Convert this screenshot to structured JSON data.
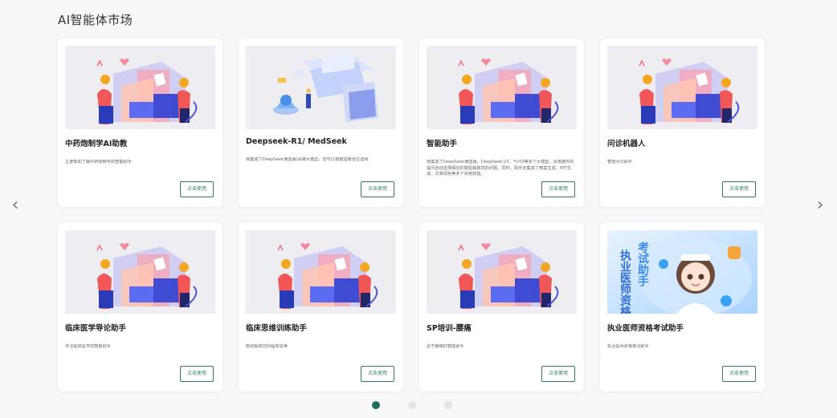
{
  "page": {
    "title": "AI智能体市场"
  },
  "nav": {
    "prev_icon": "chevron-left-icon",
    "next_icon": "chevron-right-icon",
    "prev_glyph": "‹",
    "next_glyph": "›"
  },
  "cards": [
    {
      "title": "中药炮制学AI助教",
      "desc": "主要帮助了解中药炮制学的智能助手",
      "button": "点击使用",
      "image": "people-illustration"
    },
    {
      "title": "Deepseek-R1/ MedSeek",
      "desc": "我集成了DeepSeek满血版/深速大模型，您可以根据需要自主选择",
      "button": "点击使用",
      "image": "tech-illustration"
    },
    {
      "title": "智能助手",
      "desc": "我集成了DeepSeek满血版、DeepSeek-V3、千问3等多个大模型，会根据你的提问自动选择相应的模型解答您的问题。同时，助手还集成了教案生成、PPT生成、文章润色等多个实用技能。",
      "button": "点击使用",
      "image": "people-illustration"
    },
    {
      "title": "问诊机器人",
      "desc": "智能问诊助手",
      "button": "点击使用",
      "image": "people-illustration"
    },
    {
      "title": "临床医学导论助手",
      "desc": "专注临床医学的智能助手",
      "button": "点击使用",
      "image": "people-illustration"
    },
    {
      "title": "临床思维训练助手",
      "desc": "帮助锻炼您的临床思维",
      "button": "点击使用",
      "image": "people-illustration"
    },
    {
      "title": "SP培训-腰痛",
      "desc": "关于腰痛的智能助手",
      "button": "点击使用",
      "image": "people-illustration"
    },
    {
      "title": "执业医师资格考试助手",
      "desc": "执业医师资格考试助手",
      "button": "点击使用",
      "image": "exam-illustration",
      "image_text": {
        "col1": "执业医师资格",
        "col2": "考试助手"
      }
    }
  ],
  "pagination": {
    "total": 3,
    "active": 1
  },
  "colors": {
    "accent": "#2f7d5e",
    "active_dot": "#1f6f5a",
    "inactive_dot": "#e4e4e4"
  }
}
